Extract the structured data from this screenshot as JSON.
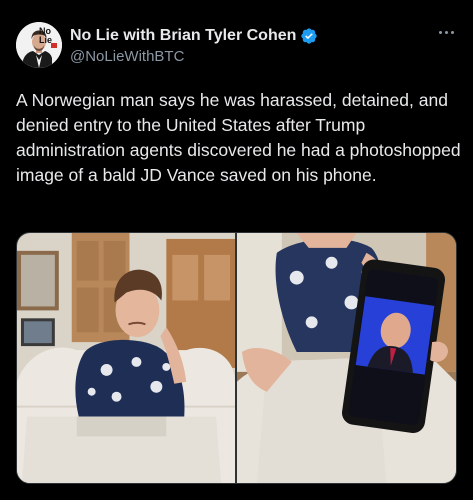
{
  "author": {
    "display_name": "No Lie with Brian Tyler Cohen",
    "handle": "@NoLieWithBTC",
    "avatar_logo_text": "No Lie"
  },
  "tweet": {
    "text": "A Norwegian man says he was harassed, detained, and denied entry to the United States after Trump administration agents discovered he had a photoshopped image of a bald JD Vance saved on his phone."
  },
  "icons": {
    "verified": "verified-badge-icon",
    "more": "more-options-icon"
  },
  "colors": {
    "background": "#000000",
    "text": "#e7e9ea",
    "secondary_text": "#8b98a5",
    "verified_blue": "#1d9bf0"
  }
}
